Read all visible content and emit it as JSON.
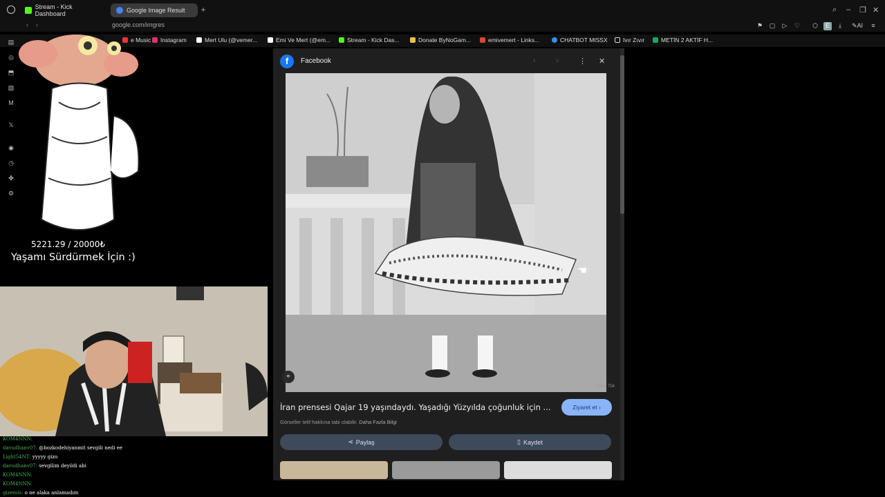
{
  "tabs": [
    {
      "label": "Stream - Kick Dashboard",
      "icon": "kick-icon",
      "color": "#53fc18"
    },
    {
      "label": "Google Image Result",
      "icon": "google-icon",
      "color": "#4285f4",
      "active": true
    }
  ],
  "address": {
    "url": "google.com/imgres"
  },
  "bookmarks": [
    {
      "label": "e Music",
      "icon": "music-icon",
      "color": "#e33"
    },
    {
      "label": "Instagram",
      "icon": "instagram-icon",
      "color": "#e1306c"
    },
    {
      "label": "Mert Ulu (@vemer...",
      "icon": "tiktok-icon",
      "color": "#fff"
    },
    {
      "label": "Emi Ve Mert (@em...",
      "icon": "x-icon",
      "color": "#fff"
    },
    {
      "label": "Stream - Kick Das...",
      "icon": "kick-icon",
      "color": "#53fc18"
    },
    {
      "label": "Donate ByNoGam...",
      "icon": "donate-icon",
      "color": "#e8c34a"
    },
    {
      "label": "emivemert - Links...",
      "icon": "linktree-icon",
      "color": "#d9462f"
    },
    {
      "label": "CHATBOT MISSX",
      "icon": "bot-icon",
      "color": "#3b8ef0"
    },
    {
      "label": "Ivır Zıvır",
      "icon": "folder-icon",
      "color": "#ddd"
    },
    {
      "label": "METİN 2 AKTİF H...",
      "icon": "sheet-icon",
      "color": "#21a366"
    }
  ],
  "overlay": {
    "donation_progress": "5221.29 / 20000₺",
    "donation_label": "Yaşamı Sürdürmek İçin :)"
  },
  "chat": [
    {
      "user": "KOM4NNN:",
      "msg": ""
    },
    {
      "user": "davudhanv07:",
      "msg": "@bozkodehiyanmit sevgili nedi ee"
    },
    {
      "user": "Light54NT:",
      "msg": "yyyyy gizo"
    },
    {
      "user": "davudhanv07:",
      "msg": "sevgilim deyildi abi"
    },
    {
      "user": "KOM4NNN:",
      "msg": ""
    },
    {
      "user": "KOM4NNN:",
      "msg": ""
    },
    {
      "user": "gizemls:",
      "msg": "o ne alaka anlamadım"
    }
  ],
  "panel": {
    "source": "Facebook",
    "image_dims": "720 × 716",
    "caption": "İran prensesi Qajar 19 yaşındaydı. Yaşadığı Yüzyılda çoğunluk için ...",
    "copyright": "Görseller telif hakkına tabi olabilir.",
    "learn_more": "Daha Fazla Bilgi",
    "visit_label": "Ziyaret et",
    "share_label": "Paylaş",
    "save_label": "Kaydet"
  }
}
